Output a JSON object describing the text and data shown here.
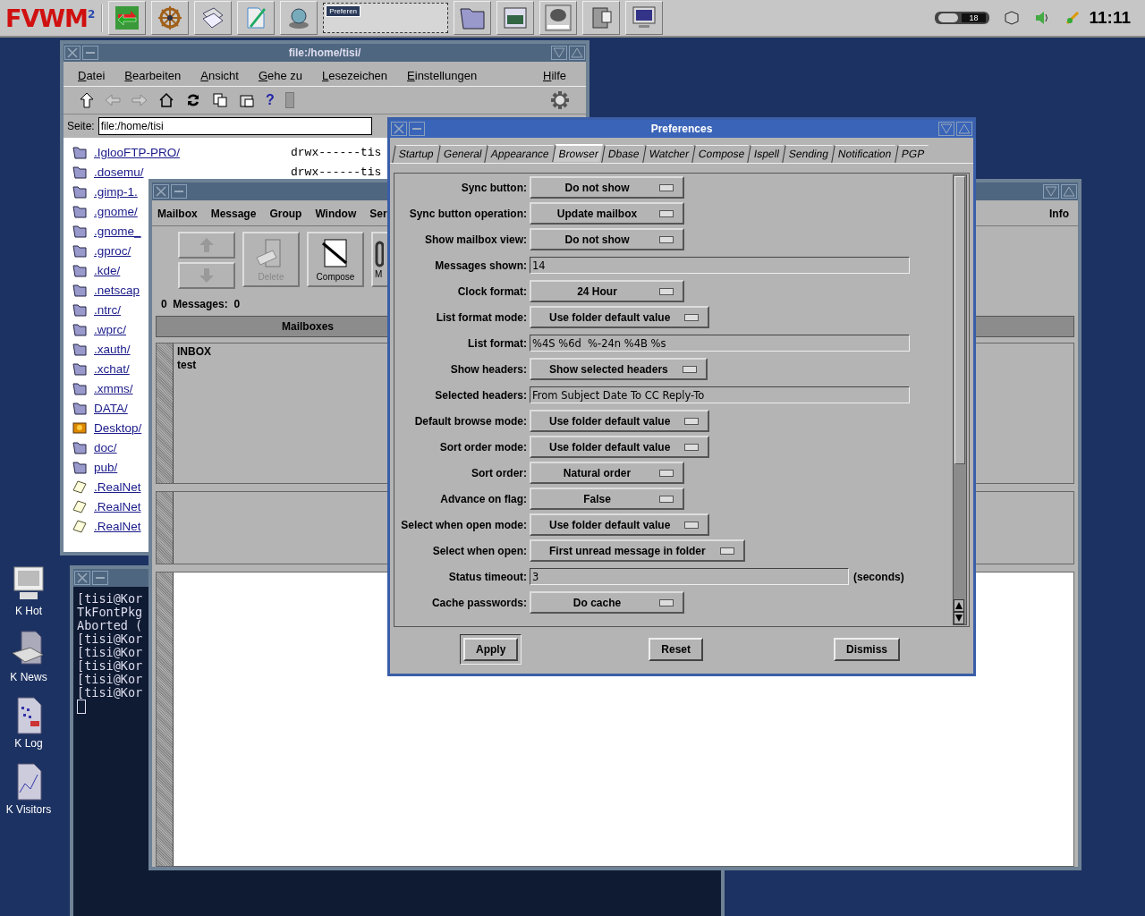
{
  "taskbar": {
    "logo": "FVWM$^{2}$",
    "pager_window": "Preferen",
    "tray_counter": "18",
    "clock": "11:11"
  },
  "desktop_icons": [
    {
      "label": "K Hot",
      "kind": "monitor"
    },
    {
      "label": "K News",
      "kind": "news"
    },
    {
      "label": "K Log",
      "kind": "log"
    },
    {
      "label": "K Visitors",
      "kind": "chart"
    }
  ],
  "file_manager": {
    "title": "file:/home/tisi/",
    "menu": [
      "Datei",
      "Bearbeiten",
      "Ansicht",
      "Gehe zu",
      "Lesezeichen",
      "Einstellungen"
    ],
    "menu_right": "Hilfe",
    "help_button": "?",
    "location_label": "Seite:",
    "location": "file:/home/tisi",
    "files": [
      {
        "name": ".IglooFTP-PRO/",
        "kind": "folder",
        "permissions": "drwx------tis"
      },
      {
        "name": ".dosemu/",
        "kind": "folder",
        "permissions": "drwx------tis"
      },
      {
        "name": ".gimp-1.",
        "kind": "folder"
      },
      {
        "name": ".gnome/",
        "kind": "folder"
      },
      {
        "name": ".gnome_",
        "kind": "folder"
      },
      {
        "name": ".gproc/",
        "kind": "folder"
      },
      {
        "name": ".kde/",
        "kind": "folder"
      },
      {
        "name": ".netscap",
        "kind": "folder"
      },
      {
        "name": ".ntrc/",
        "kind": "folder"
      },
      {
        "name": ".wprc/",
        "kind": "folder"
      },
      {
        "name": ".xauth/",
        "kind": "folder"
      },
      {
        "name": ".xchat/",
        "kind": "folder"
      },
      {
        "name": ".xmms/",
        "kind": "folder"
      },
      {
        "name": "DATA/",
        "kind": "folder"
      },
      {
        "name": "Desktop/",
        "kind": "desktop"
      },
      {
        "name": "doc/",
        "kind": "folder"
      },
      {
        "name": "pub/",
        "kind": "folder"
      },
      {
        "name": ".RealNet",
        "kind": "file"
      },
      {
        "name": ".RealNet",
        "kind": "file"
      },
      {
        "name": ".RealNet",
        "kind": "file"
      }
    ]
  },
  "terminal": {
    "lines": [
      "[tisi@Kor",
      "TkFontPkg",
      "Aborted (",
      "[tisi@Kor",
      "[tisi@Kor",
      "[tisi@Kor",
      "[tisi@Kor",
      "[tisi@Kor"
    ]
  },
  "mail": {
    "menu": [
      "Mailbox",
      "Message",
      "Group",
      "Window",
      "Ser"
    ],
    "menu_right": "Info",
    "toolbar": [
      {
        "kind": "up",
        "disabled": true
      },
      {
        "kind": "down",
        "disabled": true
      },
      {
        "kind": "delete",
        "label": "Delete",
        "disabled": true
      },
      {
        "kind": "compose",
        "label": "Compose",
        "disabled": false
      },
      {
        "kind": "partial",
        "label": "M"
      }
    ],
    "status": "0  Messages:  0",
    "mailboxes_header": "Mailboxes",
    "mailboxes": [
      "INBOX",
      "test"
    ]
  },
  "preferences": {
    "title": "Preferences",
    "tabs": [
      {
        "label": "Startup",
        "selected": false
      },
      {
        "label": "General",
        "selected": false
      },
      {
        "label": "Appearance",
        "selected": false
      },
      {
        "label": "Browser",
        "selected": true
      },
      {
        "label": "Dbase",
        "selected": false
      },
      {
        "label": "Watcher",
        "selected": false
      },
      {
        "label": "Compose",
        "selected": false
      },
      {
        "label": "Ispell",
        "selected": false
      },
      {
        "label": "Sending",
        "selected": false
      },
      {
        "label": "Notification",
        "selected": false
      },
      {
        "label": "PGP",
        "selected": false
      }
    ],
    "rows": [
      {
        "label": "Sync button:",
        "kind": "menu",
        "value": "Do not show"
      },
      {
        "label": "Sync button operation:",
        "kind": "menu",
        "value": "Update mailbox"
      },
      {
        "label": "Show mailbox view:",
        "kind": "menu",
        "value": "Do not show"
      },
      {
        "label": "Messages shown:",
        "kind": "entry",
        "value": "14"
      },
      {
        "label": "Clock format:",
        "kind": "menu",
        "value": "24 Hour"
      },
      {
        "label": "List format mode:",
        "kind": "menu",
        "value": "Use folder default value"
      },
      {
        "label": "List format:",
        "kind": "entry",
        "value": "%4S %6d  %-24n %4B %s"
      },
      {
        "label": "Show headers:",
        "kind": "menu",
        "value": "Show selected headers"
      },
      {
        "label": "Selected headers:",
        "kind": "entry",
        "value": "From Subject Date To CC Reply-To"
      },
      {
        "label": "Default browse mode:",
        "kind": "menu",
        "value": "Use folder default value"
      },
      {
        "label": "Sort order mode:",
        "kind": "menu",
        "value": "Use folder default value"
      },
      {
        "label": "Sort order:",
        "kind": "menu",
        "value": "Natural order"
      },
      {
        "label": "Advance on flag:",
        "kind": "menu",
        "value": "False"
      },
      {
        "label": "Select when open mode:",
        "kind": "menu",
        "value": "Use folder default value"
      },
      {
        "label": "Select when open:",
        "kind": "menu",
        "value": "First unread message in folder"
      },
      {
        "label": "Status timeout:",
        "kind": "entry",
        "value": "3",
        "suffix": "(seconds)"
      },
      {
        "label": "Cache passwords:",
        "kind": "menu",
        "value": "Do cache"
      }
    ],
    "buttons": [
      {
        "label": "Apply",
        "default": true
      },
      {
        "label": "Reset",
        "default": false
      },
      {
        "label": "Dismiss",
        "default": false
      }
    ]
  }
}
